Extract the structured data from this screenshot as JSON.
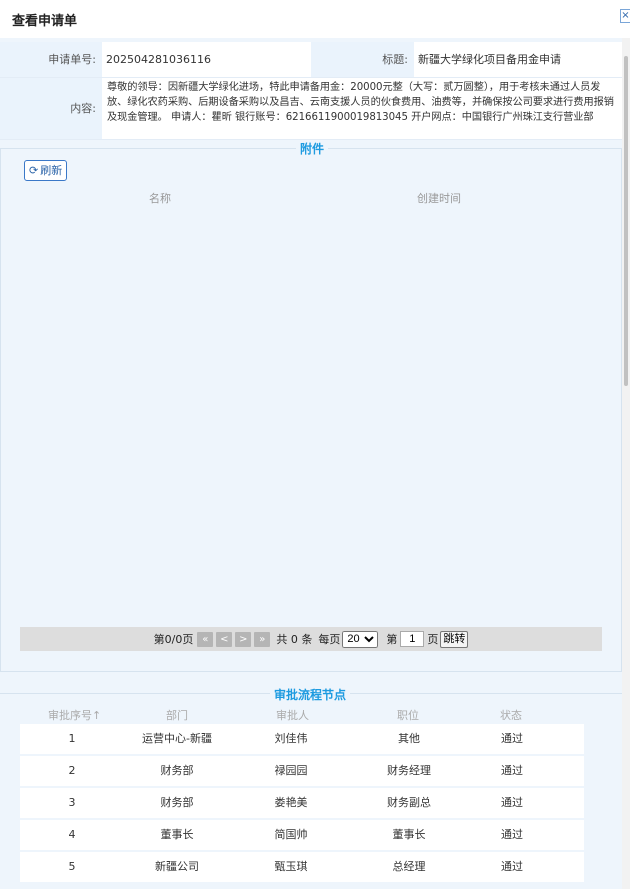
{
  "window": {
    "title": "查看申请单",
    "close_label": "×"
  },
  "form": {
    "number_label": "申请单号:",
    "number_value": "202504281036116",
    "title_label": "标题:",
    "title_value": "新疆大学绿化项目备用金申请",
    "content_label": "内容:",
    "content_value": "尊敬的领导：因新疆大学绿化进场，特此申请备用金：20000元整（大写：贰万圆整），用于考核未通过人员发放、绿化农药采购、后期设备采购以及昌吉、云南支援人员的伙食费用、油费等，并确保按公司要求进行费用报销及现金管理。 申请人：瞿昕 银行账号：6216611900019813045 开户网点：中国银行广州珠江支行营业部"
  },
  "attachments": {
    "section_title": "附件",
    "refresh_label": "刷新",
    "columns": [
      "名称",
      "创建时间"
    ],
    "rows": []
  },
  "pager": {
    "page_info": "第0/0页",
    "total": "共 0 条",
    "per_page_label": "每页",
    "per_page_value": "20",
    "page_prefix": "第",
    "page_input": "1",
    "page_suffix": "页",
    "go_label": "跳转"
  },
  "approval": {
    "section_title": "审批流程节点",
    "columns": [
      "审批序号↑",
      "部门",
      "审批人",
      "职位",
      "状态"
    ],
    "rows": [
      {
        "seq": "1",
        "dept": "运营中心-新疆",
        "approver": "刘佳伟",
        "position": "其他",
        "status": "通过"
      },
      {
        "seq": "2",
        "dept": "财务部",
        "approver": "禄园园",
        "position": "财务经理",
        "status": "通过"
      },
      {
        "seq": "3",
        "dept": "财务部",
        "approver": "娄艳美",
        "position": "财务副总",
        "status": "通过"
      },
      {
        "seq": "4",
        "dept": "董事长",
        "approver": "简国帅",
        "position": "董事长",
        "status": "通过"
      },
      {
        "seq": "5",
        "dept": "新疆公司",
        "approver": "甄玉琪",
        "position": "总经理",
        "status": "通过"
      }
    ]
  }
}
